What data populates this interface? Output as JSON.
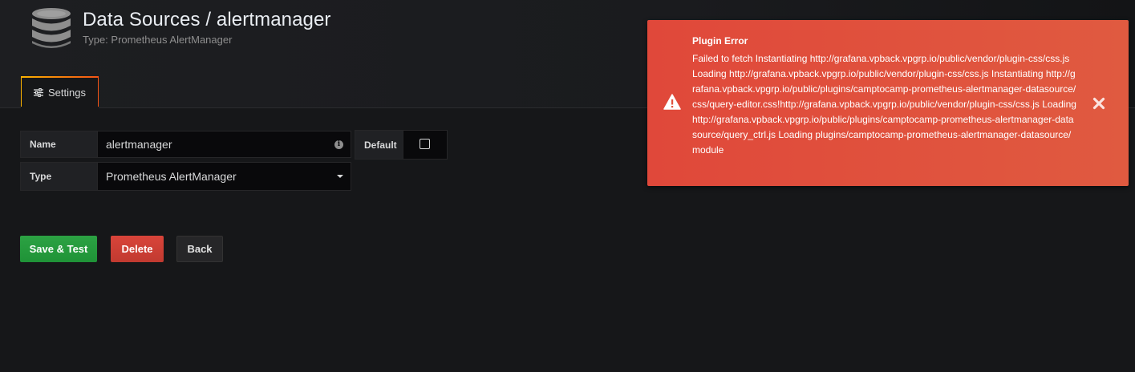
{
  "header": {
    "title": "Data Sources / alertmanager",
    "subtitle": "Type: Prometheus AlertManager",
    "icon": "database-icon"
  },
  "tabs": [
    {
      "label": "Settings",
      "icon": "sliders-icon",
      "active": true
    }
  ],
  "form": {
    "name_label": "Name",
    "name_value": "alertmanager",
    "default_label": "Default",
    "default_checked": false,
    "type_label": "Type",
    "type_value": "Prometheus AlertManager"
  },
  "buttons": {
    "save": "Save & Test",
    "delete": "Delete",
    "back": "Back"
  },
  "alert": {
    "title": "Plugin Error",
    "message": "Failed to fetch Instantiating http://grafana.vpback.vpgrp.io/public/vendor/plugin-css/css.js Loading http://grafana.vpback.vpgrp.io/public/vendor/plugin-css/css.js Instantiating http://grafana.vpback.vpgrp.io/public/plugins/camptocamp-prometheus-alertmanager-datasource/css/query-editor.css!http://grafana.vpback.vpgrp.io/public/vendor/plugin-css/css.js Loading http://grafana.vpback.vpgrp.io/public/plugins/camptocamp-prometheus-alertmanager-datasource/query_ctrl.js Loading plugins/camptocamp-prometheus-alertmanager-datasource/module",
    "icon": "warning-icon",
    "close_icon": "close-icon"
  },
  "colors": {
    "background": "#161719",
    "save": "#299c46",
    "delete": "#d44a3a",
    "alert": "#e0523e",
    "tab_accent": "#fbb300"
  }
}
